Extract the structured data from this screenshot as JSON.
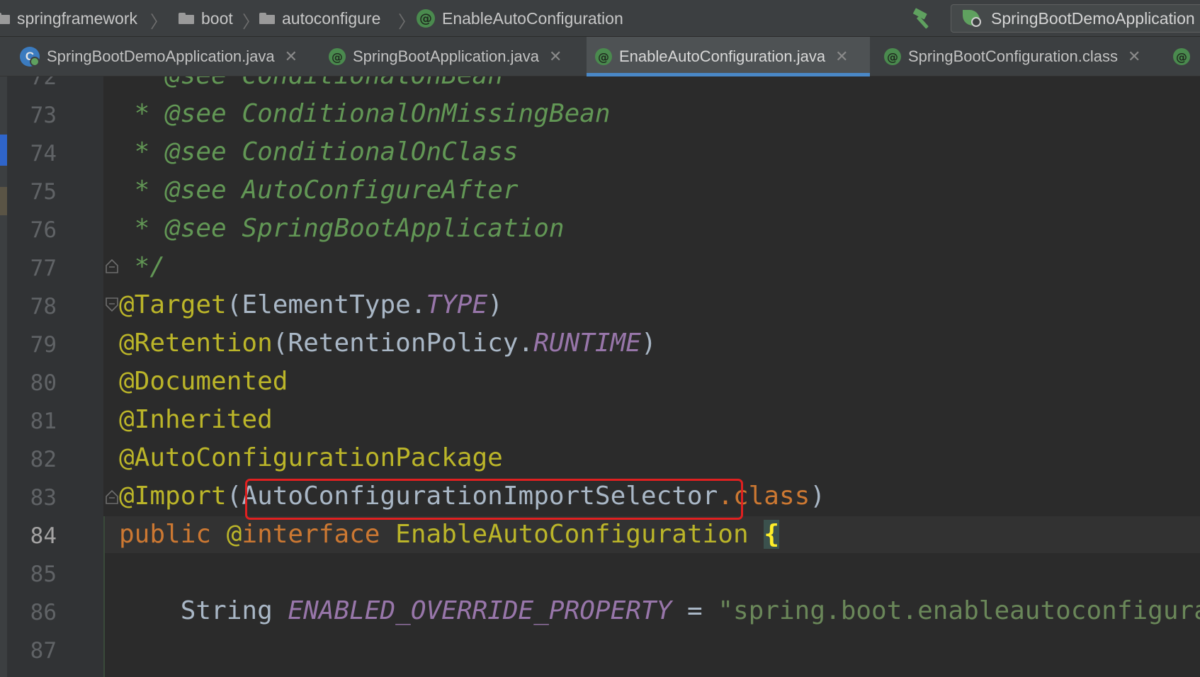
{
  "breadcrumbs": [
    {
      "label": "springframework",
      "icon": "folder-icon"
    },
    {
      "label": "boot",
      "icon": "folder-icon"
    },
    {
      "label": "autoconfigure",
      "icon": "folder-icon"
    },
    {
      "label": "EnableAutoConfiguration",
      "icon": "annotation-icon"
    }
  ],
  "toolbar": {
    "build_icon": "hammer-icon",
    "run_config": "SpringBootDemoApplication"
  },
  "tabs": [
    {
      "label": "SpringBootDemoApplication.java",
      "close": "✕",
      "active": false
    },
    {
      "label": "SpringBootApplication.java",
      "close": "✕",
      "active": false
    },
    {
      "label": "EnableAutoConfiguration.java",
      "close": "✕",
      "active": true
    },
    {
      "label": "SpringBootConfiguration.class",
      "close": "✕",
      "active": false
    }
  ],
  "editor": {
    "current_line": 84,
    "lines": [
      {
        "n": "72",
        "t": [
          [
            "doc",
            " * "
          ],
          [
            "doc tag",
            "@see"
          ],
          [
            "doc",
            " "
          ],
          [
            "doc ref",
            "ConditionalOnBean"
          ]
        ]
      },
      {
        "n": "73",
        "t": [
          [
            "doc",
            " * "
          ],
          [
            "doc tag",
            "@see"
          ],
          [
            "doc",
            " "
          ],
          [
            "doc ref",
            "ConditionalOnMissingBean"
          ]
        ]
      },
      {
        "n": "74",
        "t": [
          [
            "doc",
            " * "
          ],
          [
            "doc tag",
            "@see"
          ],
          [
            "doc",
            " "
          ],
          [
            "doc ref",
            "ConditionalOnClass"
          ]
        ]
      },
      {
        "n": "75",
        "t": [
          [
            "doc",
            " * "
          ],
          [
            "doc tag",
            "@see"
          ],
          [
            "doc",
            " "
          ],
          [
            "doc ref",
            "AutoConfigureAfter"
          ]
        ]
      },
      {
        "n": "76",
        "t": [
          [
            "doc",
            " * "
          ],
          [
            "doc tag",
            "@see"
          ],
          [
            "doc",
            " "
          ],
          [
            "doc ref",
            "SpringBootApplication"
          ]
        ]
      },
      {
        "n": "77",
        "t": [
          [
            "doc",
            " */"
          ]
        ]
      },
      {
        "n": "78",
        "t": [
          [
            "ann",
            "@Target"
          ],
          [
            "plain",
            "(ElementType."
          ],
          [
            "const",
            "TYPE"
          ],
          [
            "plain",
            ")"
          ]
        ]
      },
      {
        "n": "79",
        "t": [
          [
            "ann",
            "@Retention"
          ],
          [
            "plain",
            "(RetentionPolicy."
          ],
          [
            "const",
            "RUNTIME"
          ],
          [
            "plain",
            ")"
          ]
        ]
      },
      {
        "n": "80",
        "t": [
          [
            "ann",
            "@Documented"
          ]
        ]
      },
      {
        "n": "81",
        "t": [
          [
            "ann",
            "@Inherited"
          ]
        ]
      },
      {
        "n": "82",
        "t": [
          [
            "ann",
            "@AutoConfigurationPackage"
          ]
        ]
      },
      {
        "n": "83",
        "t": [
          [
            "ann",
            "@Import"
          ],
          [
            "plain",
            "(AutoConfigurationImportSelector"
          ],
          [
            "kw",
            ".class"
          ],
          [
            "plain",
            ")"
          ]
        ]
      },
      {
        "n": "84",
        "t": [
          [
            "kw",
            "public "
          ],
          [
            "ann",
            "@"
          ],
          [
            "kw",
            "interface "
          ],
          [
            "ann",
            "EnableAutoConfiguration"
          ],
          [
            "plain",
            " "
          ],
          [
            "brace",
            "{"
          ]
        ]
      },
      {
        "n": "85",
        "t": []
      },
      {
        "n": "86",
        "t": [
          [
            "plain",
            "    String "
          ],
          [
            "const",
            "ENABLED_OVERRIDE_PROPERTY"
          ],
          [
            "plain",
            " = "
          ],
          [
            "str",
            "\"spring.boot.enableautoconfiguration\""
          ],
          [
            "plain",
            ";"
          ]
        ]
      },
      {
        "n": "87",
        "t": []
      }
    ]
  },
  "colors": {
    "accent_underline": "#4a88c7",
    "highlight_box": "#e02020"
  }
}
